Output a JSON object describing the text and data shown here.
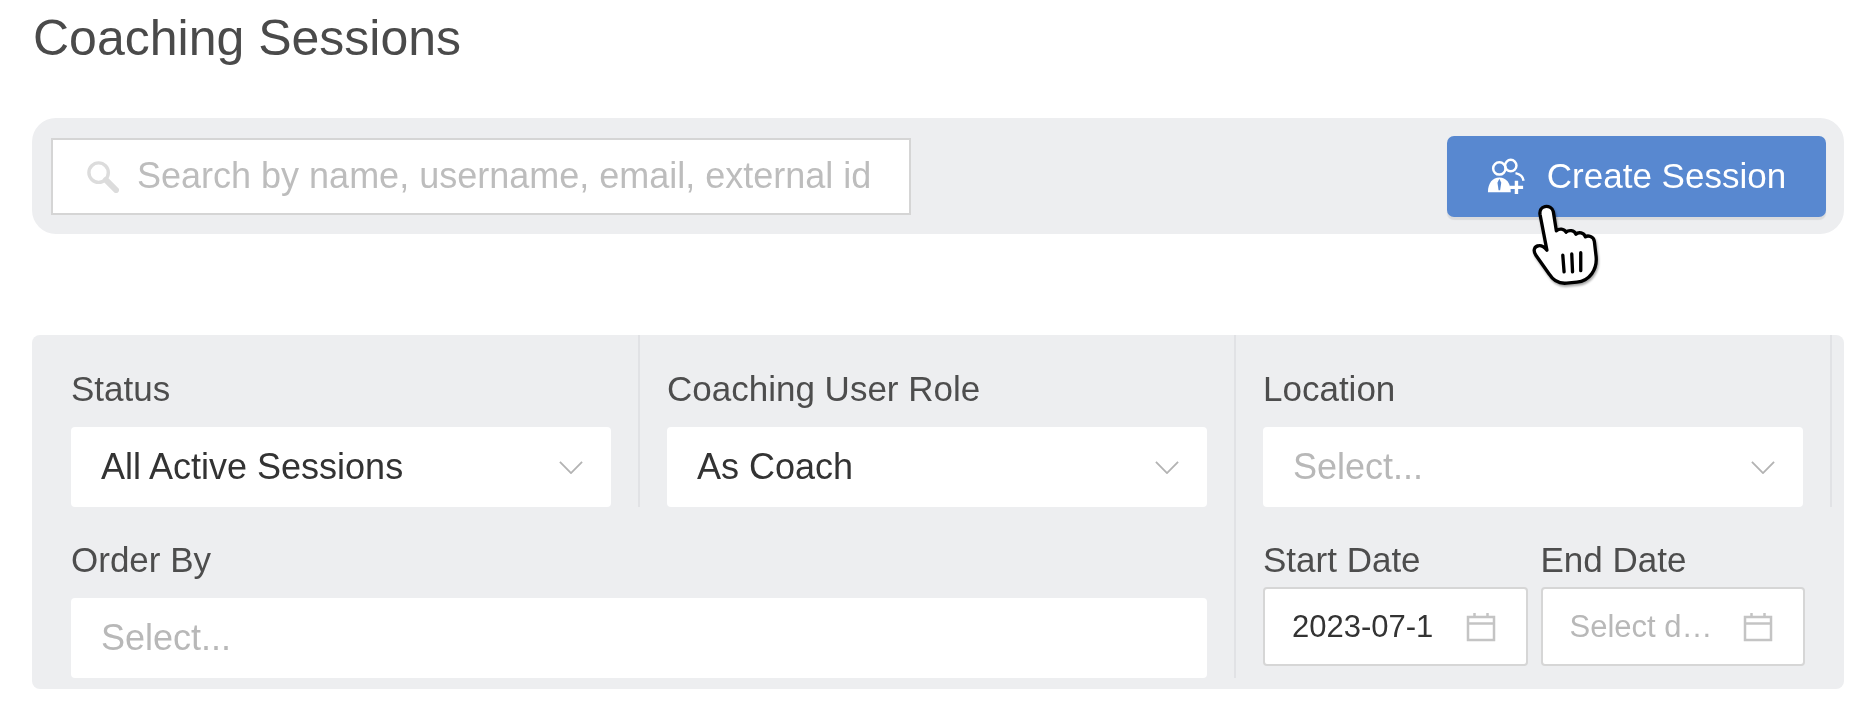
{
  "page": {
    "title": "Coaching Sessions"
  },
  "toolbar": {
    "search": {
      "placeholder": "Search by name, username, email, external id"
    },
    "create_button": {
      "label": "Create Session"
    }
  },
  "filters": {
    "rows": [
      {
        "fields": [
          {
            "kind": "select",
            "label": "Status",
            "value": "All Active Sessions"
          },
          {
            "kind": "select",
            "label": "Coaching User Role",
            "value": "As Coach"
          },
          {
            "kind": "select",
            "label": "Location",
            "placeholder": "Select..."
          }
        ]
      },
      {
        "fields": [
          {
            "kind": "multiselect",
            "label": "Order By",
            "placeholder": "Select..."
          },
          {
            "kind": "date_range",
            "dates": [
              {
                "label": "Start Date",
                "value": "2023-07-1"
              },
              {
                "label": "End Date",
                "placeholder": "Select d…"
              }
            ]
          }
        ]
      }
    ]
  }
}
